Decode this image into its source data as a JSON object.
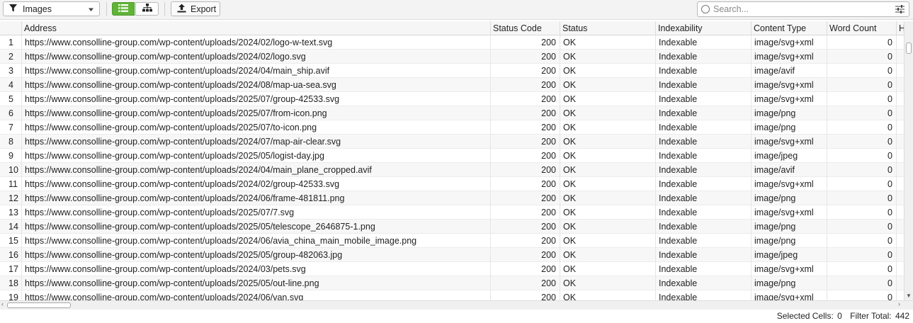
{
  "toolbar": {
    "filter_value": "Images",
    "export_label": "Export",
    "search_placeholder": "Search..."
  },
  "columns": [
    "Address",
    "Status Code",
    "Status",
    "Indexability",
    "Content Type",
    "Word Count",
    "H"
  ],
  "rows": [
    {
      "n": "1",
      "address": "https://www.consolline-group.com/wp-content/uploads/2024/02/logo-w-text.svg",
      "code": "200",
      "status": "OK",
      "indexability": "Indexable",
      "type": "image/svg+xml",
      "words": "0"
    },
    {
      "n": "2",
      "address": "https://www.consolline-group.com/wp-content/uploads/2024/02/logo.svg",
      "code": "200",
      "status": "OK",
      "indexability": "Indexable",
      "type": "image/svg+xml",
      "words": "0"
    },
    {
      "n": "3",
      "address": "https://www.consolline-group.com/wp-content/uploads/2024/04/main_ship.avif",
      "code": "200",
      "status": "OK",
      "indexability": "Indexable",
      "type": "image/avif",
      "words": "0"
    },
    {
      "n": "4",
      "address": "https://www.consolline-group.com/wp-content/uploads/2024/08/map-ua-sea.svg",
      "code": "200",
      "status": "OK",
      "indexability": "Indexable",
      "type": "image/svg+xml",
      "words": "0"
    },
    {
      "n": "5",
      "address": "https://www.consolline-group.com/wp-content/uploads/2025/07/group-42533.svg",
      "code": "200",
      "status": "OK",
      "indexability": "Indexable",
      "type": "image/svg+xml",
      "words": "0"
    },
    {
      "n": "6",
      "address": "https://www.consolline-group.com/wp-content/uploads/2025/07/from-icon.png",
      "code": "200",
      "status": "OK",
      "indexability": "Indexable",
      "type": "image/png",
      "words": "0"
    },
    {
      "n": "7",
      "address": "https://www.consolline-group.com/wp-content/uploads/2025/07/to-icon.png",
      "code": "200",
      "status": "OK",
      "indexability": "Indexable",
      "type": "image/png",
      "words": "0"
    },
    {
      "n": "8",
      "address": "https://www.consolline-group.com/wp-content/uploads/2024/07/map-air-clear.svg",
      "code": "200",
      "status": "OK",
      "indexability": "Indexable",
      "type": "image/svg+xml",
      "words": "0"
    },
    {
      "n": "9",
      "address": "https://www.consolline-group.com/wp-content/uploads/2025/05/logist-day.jpg",
      "code": "200",
      "status": "OK",
      "indexability": "Indexable",
      "type": "image/jpeg",
      "words": "0"
    },
    {
      "n": "10",
      "address": "https://www.consolline-group.com/wp-content/uploads/2024/04/main_plane_cropped.avif",
      "code": "200",
      "status": "OK",
      "indexability": "Indexable",
      "type": "image/avif",
      "words": "0"
    },
    {
      "n": "11",
      "address": "https://www.consolline-group.com/wp-content/uploads/2024/02/group-42533.svg",
      "code": "200",
      "status": "OK",
      "indexability": "Indexable",
      "type": "image/svg+xml",
      "words": "0"
    },
    {
      "n": "12",
      "address": "https://www.consolline-group.com/wp-content/uploads/2024/06/frame-481811.png",
      "code": "200",
      "status": "OK",
      "indexability": "Indexable",
      "type": "image/png",
      "words": "0"
    },
    {
      "n": "13",
      "address": "https://www.consolline-group.com/wp-content/uploads/2025/07/7.svg",
      "code": "200",
      "status": "OK",
      "indexability": "Indexable",
      "type": "image/svg+xml",
      "words": "0"
    },
    {
      "n": "14",
      "address": "https://www.consolline-group.com/wp-content/uploads/2025/05/telescope_2646875-1.png",
      "code": "200",
      "status": "OK",
      "indexability": "Indexable",
      "type": "image/png",
      "words": "0"
    },
    {
      "n": "15",
      "address": "https://www.consolline-group.com/wp-content/uploads/2024/06/avia_china_main_mobile_image.png",
      "code": "200",
      "status": "OK",
      "indexability": "Indexable",
      "type": "image/png",
      "words": "0"
    },
    {
      "n": "16",
      "address": "https://www.consolline-group.com/wp-content/uploads/2025/05/group-482063.jpg",
      "code": "200",
      "status": "OK",
      "indexability": "Indexable",
      "type": "image/jpeg",
      "words": "0"
    },
    {
      "n": "17",
      "address": "https://www.consolline-group.com/wp-content/uploads/2024/03/pets.svg",
      "code": "200",
      "status": "OK",
      "indexability": "Indexable",
      "type": "image/svg+xml",
      "words": "0"
    },
    {
      "n": "18",
      "address": "https://www.consolline-group.com/wp-content/uploads/2025/05/out-line.png",
      "code": "200",
      "status": "OK",
      "indexability": "Indexable",
      "type": "image/png",
      "words": "0"
    },
    {
      "n": "19",
      "address": "https://www.consolline-group.com/wp-content/uploads/2024/06/van.svg",
      "code": "200",
      "status": "OK",
      "indexability": "Indexable",
      "type": "image/svg+xml",
      "words": "0"
    }
  ],
  "statusbar": {
    "selected_label": "Selected Cells:",
    "selected_value": "0",
    "filter_label": "Filter Total:",
    "filter_value": "442"
  },
  "icons": {
    "filter": "funnel-icon",
    "dropdown": "chevron-down-icon",
    "list_view": "list-view-icon",
    "tree_view": "tree-view-icon",
    "export": "upload-icon",
    "search": "search-icon",
    "options": "sliders-icon",
    "add_column": "plus-icon"
  },
  "colors": {
    "active_view": "#5fb336"
  }
}
